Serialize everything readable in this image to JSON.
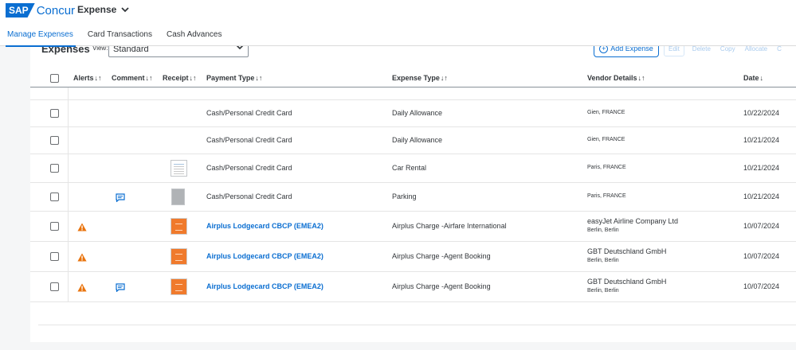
{
  "brand": {
    "sap": "SAP",
    "name": "Concur"
  },
  "app": {
    "name": "Expense"
  },
  "tabs": [
    {
      "label": "Manage Expenses",
      "active": true
    },
    {
      "label": "Card Transactions",
      "active": false
    },
    {
      "label": "Cash Advances",
      "active": false
    }
  ],
  "panel": {
    "title": "Expenses",
    "view_label": "View:",
    "view_value": "Standard"
  },
  "toolbar": {
    "add_label": "Add Expense",
    "edit_label": "Edit",
    "delete_label": "Delete",
    "copy_label": "Copy",
    "allocate_label": "Allocate",
    "more_label": "C"
  },
  "columns": {
    "alerts": "Alerts",
    "comment": "Comment",
    "receipt": "Receipt",
    "payment_type": "Payment Type",
    "expense_type": "Expense Type",
    "vendor_details": "Vendor Details",
    "date": "Date"
  },
  "rows": [
    {
      "payment_type": "Cash/Personal Credit Card",
      "expense_type": "Daily Allowance",
      "vendor_name": "",
      "vendor_loc": "Gien, FRANCE",
      "date": "10/22/2024",
      "alert": false,
      "comment": false,
      "receipt": "none"
    },
    {
      "payment_type": "Cash/Personal Credit Card",
      "expense_type": "Daily Allowance",
      "vendor_name": "",
      "vendor_loc": "Gien, FRANCE",
      "date": "10/21/2024",
      "alert": false,
      "comment": false,
      "receipt": "none"
    },
    {
      "payment_type": "Cash/Personal Credit Card",
      "expense_type": "Car Rental",
      "vendor_name": "",
      "vendor_loc": "Paris, FRANCE",
      "date": "10/21/2024",
      "alert": false,
      "comment": false,
      "receipt": "doc"
    },
    {
      "payment_type": "Cash/Personal Credit Card",
      "expense_type": "Parking",
      "vendor_name": "",
      "vendor_loc": "Paris, FRANCE",
      "date": "10/21/2024",
      "alert": false,
      "comment": true,
      "receipt": "grey"
    },
    {
      "payment_type": "Airplus Lodgecard CBCP (EMEA2)",
      "expense_type": "Airplus Charge -Airfare International",
      "vendor_name": "easyJet Airline Company Ltd",
      "vendor_loc": "Berlin, Berlin",
      "date": "10/07/2024",
      "alert": true,
      "comment": false,
      "receipt": "orange"
    },
    {
      "payment_type": "Airplus Lodgecard CBCP (EMEA2)",
      "expense_type": "Airplus Charge -Agent Booking",
      "vendor_name": "GBT Deutschland GmbH",
      "vendor_loc": "Berlin, Berlin",
      "date": "10/07/2024",
      "alert": true,
      "comment": false,
      "receipt": "orange"
    },
    {
      "payment_type": "Airplus Lodgecard CBCP (EMEA2)",
      "expense_type": "Airplus Charge -Agent Booking",
      "vendor_name": "GBT Deutschland GmbH",
      "vendor_loc": "Berlin, Berlin",
      "date": "10/07/2024",
      "alert": true,
      "comment": true,
      "receipt": "orange"
    }
  ],
  "colors": {
    "accent": "#0a6ed1",
    "warning": "#e9730c"
  }
}
